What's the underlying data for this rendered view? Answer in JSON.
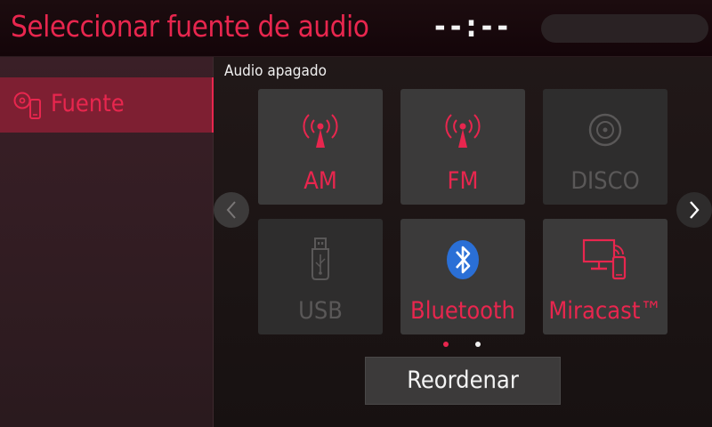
{
  "header": {
    "title": "Seleccionar fuente de audio",
    "clock": "--:--"
  },
  "sidebar": {
    "items": [
      {
        "label": "Fuente",
        "icon": "source-icon",
        "selected": true
      }
    ]
  },
  "main": {
    "status": "Audio apagado",
    "sources": [
      {
        "label": "AM",
        "icon": "antenna-icon",
        "enabled": true
      },
      {
        "label": "FM",
        "icon": "antenna-icon",
        "enabled": true
      },
      {
        "label": "DISCO",
        "icon": "disc-icon",
        "enabled": false
      },
      {
        "label": "USB",
        "icon": "usb-icon",
        "enabled": false
      },
      {
        "label": "Bluetooth",
        "icon": "bluetooth-icon",
        "enabled": true
      },
      {
        "label": "Miracast™",
        "icon": "miracast-icon",
        "enabled": true
      }
    ],
    "pagination": {
      "current": 1,
      "total": 2
    },
    "reorder_label": "Reordenar"
  },
  "colors": {
    "accent": "#e8264e",
    "bluetooth": "#2a6fd6",
    "tile": "#3b3a3a",
    "tile_disabled": "#2e2d2d"
  }
}
